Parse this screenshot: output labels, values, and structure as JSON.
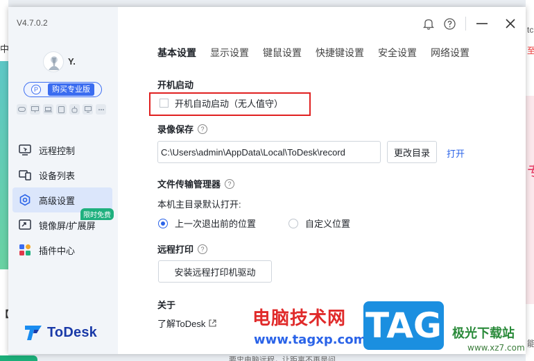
{
  "background": {
    "left_top": "中",
    "left_mid": "【",
    "right_top": "tc",
    "right_red": "至",
    "right_big": "专",
    "right_bottom": "能",
    "bottom_text": "要忠电脑远程，让距离不再是问"
  },
  "sidebar": {
    "version": "V4.7.0.2",
    "username": "Y.",
    "pro_button": "购买专业版",
    "pro_icon": "P",
    "device_icons": [
      "gamepad-icon",
      "monitor-icon",
      "laptop-icon",
      "tablet-icon",
      "robot-icon",
      "cast-icon",
      "more-icon"
    ],
    "nav": [
      {
        "label": "远程控制",
        "icon": "remote-control-icon",
        "active": false
      },
      {
        "label": "设备列表",
        "icon": "device-list-icon",
        "active": false
      },
      {
        "label": "高级设置",
        "icon": "settings-hex-icon",
        "active": true
      },
      {
        "label": "镜像屏/扩展屏",
        "icon": "mirror-screen-icon",
        "active": false,
        "badge": "限时免费"
      },
      {
        "label": "插件中心",
        "icon": "plugin-icon",
        "active": false
      }
    ],
    "logo_text": "ToDesk"
  },
  "titlebar": {
    "bell": "bell-icon",
    "help": "help-icon",
    "minimize": "minimize-icon",
    "close": "close-icon"
  },
  "tabs": [
    "基本设置",
    "显示设置",
    "键鼠设置",
    "快捷键设置",
    "安全设置",
    "网络设置"
  ],
  "startup": {
    "title": "开机启动",
    "checkbox_label": "开机自动启动（无人值守）",
    "checked": false
  },
  "recording": {
    "title": "录像保存",
    "path": "C:\\Users\\admin\\AppData\\Local\\ToDesk\\record",
    "change_button": "更改目录",
    "open_link": "打开"
  },
  "file_transfer": {
    "title": "文件传输管理器",
    "default_label": "本机主目录默认打开:",
    "options": [
      "上一次退出前的位置",
      "自定义位置"
    ],
    "selected": 0
  },
  "remote_print": {
    "title": "远程打印",
    "install_button": "安装远程打印机驱动"
  },
  "about": {
    "title": "关于",
    "link": "了解ToDesk"
  },
  "watermark": {
    "site_name": "电脑技术网",
    "site_url": "www.tagxp.com",
    "tag": "TAG",
    "brand": "极光下载站",
    "brand_url": "www.xz7.com"
  },
  "colors": {
    "accent": "#2a63e8",
    "active_nav_bg": "#dbe6fb",
    "badge_green": "#1fb07e",
    "highlight_red": "#e02020"
  }
}
